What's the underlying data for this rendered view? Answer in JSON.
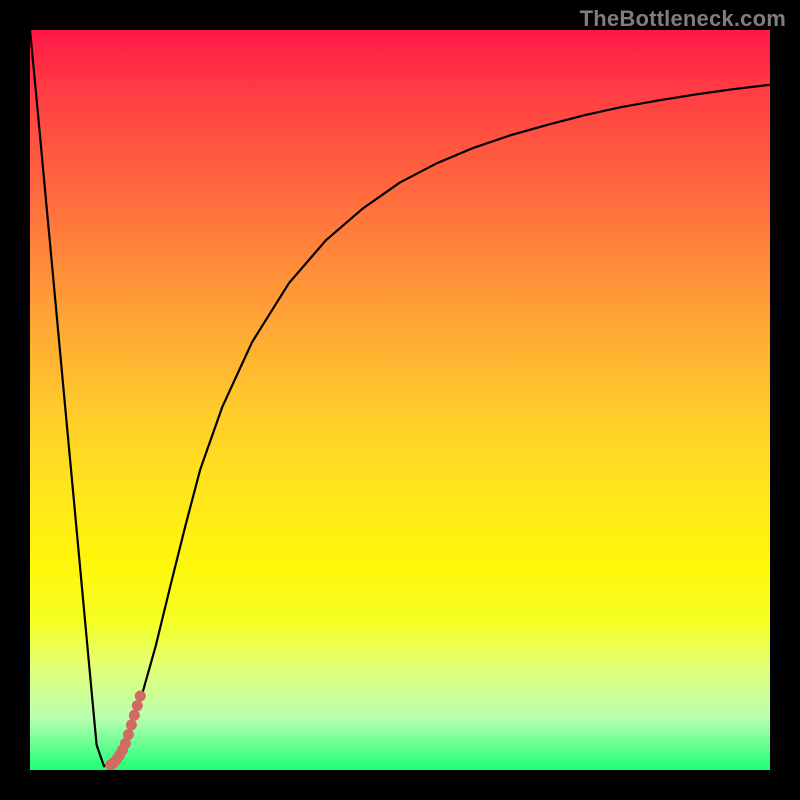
{
  "watermark": "TheBottleneck.com",
  "colors": {
    "frame": "#000000",
    "curve": "#000000",
    "marker": "#d16a62",
    "gradient_top": "#ff1846",
    "gradient_bottom": "#1eff74"
  },
  "chart_data": {
    "type": "line",
    "title": "",
    "xlabel": "",
    "ylabel": "",
    "xlim": [
      0,
      100
    ],
    "ylim": [
      0,
      100
    ],
    "grid": false,
    "series": [
      {
        "name": "bottleneck-curve",
        "x": [
          0,
          1,
          2,
          3,
          4,
          5,
          6,
          7,
          8,
          9,
          10,
          11,
          12,
          13,
          14,
          15,
          17,
          19,
          21,
          23,
          26,
          30,
          35,
          40,
          45,
          50,
          55,
          60,
          65,
          70,
          75,
          80,
          85,
          90,
          95,
          100
        ],
        "values": [
          100,
          89.5,
          78.7,
          68.0,
          57.2,
          46.4,
          35.7,
          24.9,
          14.1,
          3.4,
          0.5,
          1.2,
          2.3,
          4.0,
          6.5,
          9.7,
          16.8,
          25.0,
          33.0,
          40.6,
          49.1,
          57.8,
          65.8,
          71.6,
          75.9,
          79.4,
          82.0,
          84.1,
          85.8,
          87.2,
          88.5,
          89.6,
          90.5,
          91.3,
          92.0,
          92.6
        ]
      }
    ],
    "annotations": [
      {
        "name": "highlight-segment",
        "x": [
          14.9,
          14.5,
          14.1,
          13.7,
          13.3,
          12.9,
          12.5,
          12.1,
          11.7,
          11.3,
          10.9
        ],
        "y": [
          10.0,
          8.7,
          7.4,
          6.1,
          4.8,
          3.6,
          2.7,
          2.0,
          1.4,
          1.0,
          0.7
        ]
      }
    ]
  }
}
